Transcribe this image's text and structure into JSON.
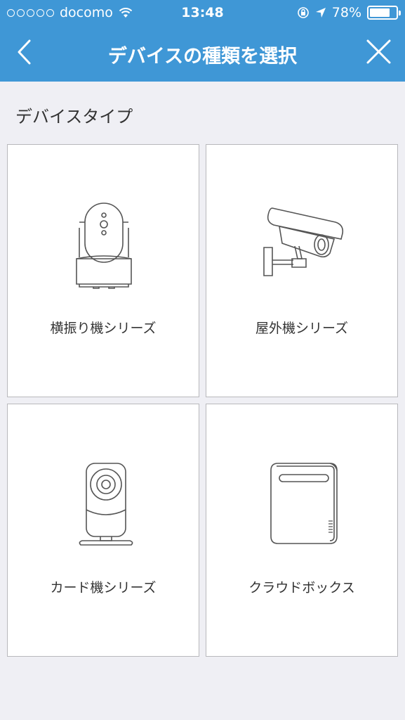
{
  "status_bar": {
    "carrier": "docomo",
    "time": "13:48",
    "battery": "78%",
    "battery_level": 0.78,
    "icons": [
      "signal-dots-icon",
      "wifi-icon",
      "orientation-lock-icon",
      "location-arrow-icon",
      "battery-icon"
    ]
  },
  "nav": {
    "title": "デバイスの種類を選択",
    "back_icon": "chevron-left-icon",
    "close_icon": "close-icon"
  },
  "section": {
    "label": "デバイスタイプ"
  },
  "devices": [
    {
      "label": "横振り機シリーズ",
      "icon": "pan-tilt-camera-icon"
    },
    {
      "label": "屋外機シリーズ",
      "icon": "outdoor-bullet-camera-icon"
    },
    {
      "label": "カード機シリーズ",
      "icon": "cube-camera-icon"
    },
    {
      "label": "クラウドボックス",
      "icon": "cloud-box-icon"
    }
  ],
  "colors": {
    "accent": "#3f97d6",
    "background": "#efeff4",
    "card_border": "#b8b8bc",
    "text": "#333333"
  }
}
